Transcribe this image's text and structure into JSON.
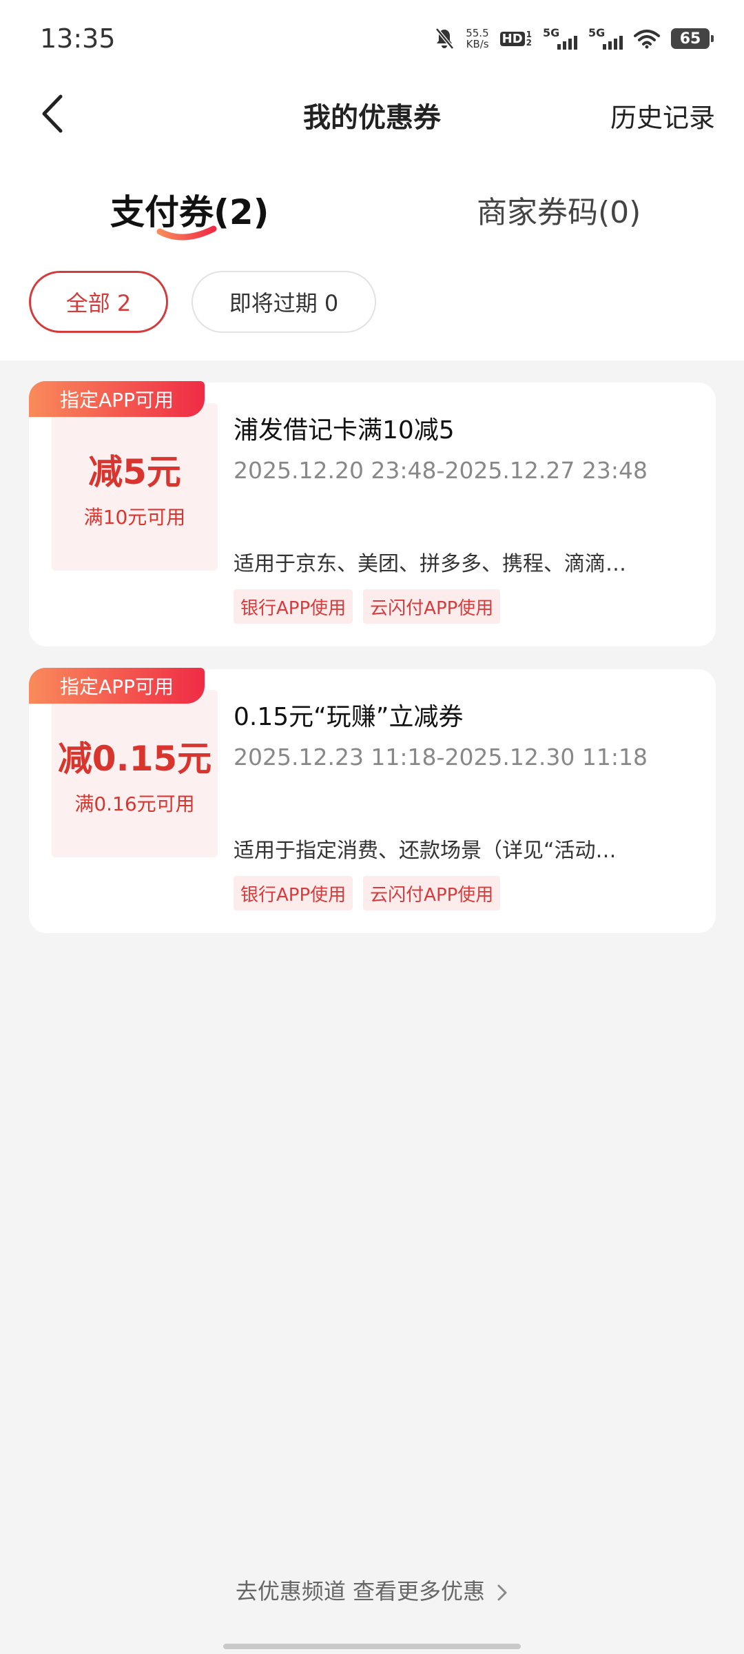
{
  "status_bar": {
    "time": "13:35",
    "net_speed_value": "55.5",
    "net_speed_unit": "KB/s",
    "hd_label": "HD",
    "hd_sub_top": "1",
    "hd_sub_bottom": "2",
    "sim1_label": "5G",
    "sim2_label": "5G",
    "battery": "65",
    "icons": [
      "mute-bell-icon",
      "wifi-icon",
      "battery-icon"
    ]
  },
  "header": {
    "title": "我的优惠券",
    "right_action": "历史记录"
  },
  "tabs": [
    {
      "label": "支付券(2)",
      "active": true
    },
    {
      "label": "商家券码(0)",
      "active": false
    }
  ],
  "filters": [
    {
      "label": "全部 2",
      "active": true
    },
    {
      "label": "即将过期 0",
      "active": false
    }
  ],
  "coupons": [
    {
      "badge": "指定APP可用",
      "amount": "减5元",
      "condition": "满10元可用",
      "title": "浦发借记卡满10减5",
      "period": "2025.12.20 23:48-2025.12.27 23:48",
      "desc": "适用于京东、美团、拼多多、携程、滴滴…",
      "tags": [
        "银行APP使用",
        "云闪付APP使用"
      ]
    },
    {
      "badge": "指定APP可用",
      "amount": "减0.15元",
      "condition": "满0.16元可用",
      "title": "0.15元“玩赚”立减券",
      "period": "2025.12.23 11:18-2025.12.30 11:18",
      "desc": "适用于指定消费、还款场景（详见“活动…",
      "tags": [
        "银行APP使用",
        "云闪付APP使用"
      ]
    }
  ],
  "footer": {
    "link": "去优惠频道 查看更多优惠"
  },
  "colors": {
    "accent": "#d8352f",
    "badge_gradient_start": "#f98a5b",
    "badge_gradient_end": "#ef2c45",
    "page_bg": "#f4f4f4"
  }
}
